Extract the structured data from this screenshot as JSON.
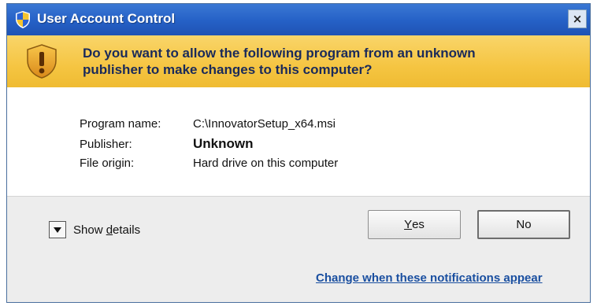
{
  "window": {
    "title": "User Account Control",
    "close_glyph": "×",
    "icons": {
      "title": "uac-shield-icon",
      "warning": "warning-shield-icon"
    }
  },
  "banner": {
    "line1": "Do you want to allow the following program from an unknown",
    "line2": "publisher to make changes to this computer?"
  },
  "details": {
    "rows": [
      {
        "label": "Program name:",
        "value": "C:\\InnovatorSetup_x64.msi"
      },
      {
        "label": "Publisher:",
        "value": "Unknown"
      },
      {
        "label": "File origin:",
        "value": "Hard drive on this computer"
      }
    ]
  },
  "footer": {
    "show_details_prefix": "Show ",
    "show_details_accel": "d",
    "show_details_rest": "etails",
    "yes_accel": "Y",
    "yes_rest": "es",
    "no_label": "No",
    "link_label": "Change when these notifications appear"
  },
  "colors": {
    "title_bar": "#2560c6",
    "banner": "#f5c542",
    "link": "#1a4fa0"
  }
}
